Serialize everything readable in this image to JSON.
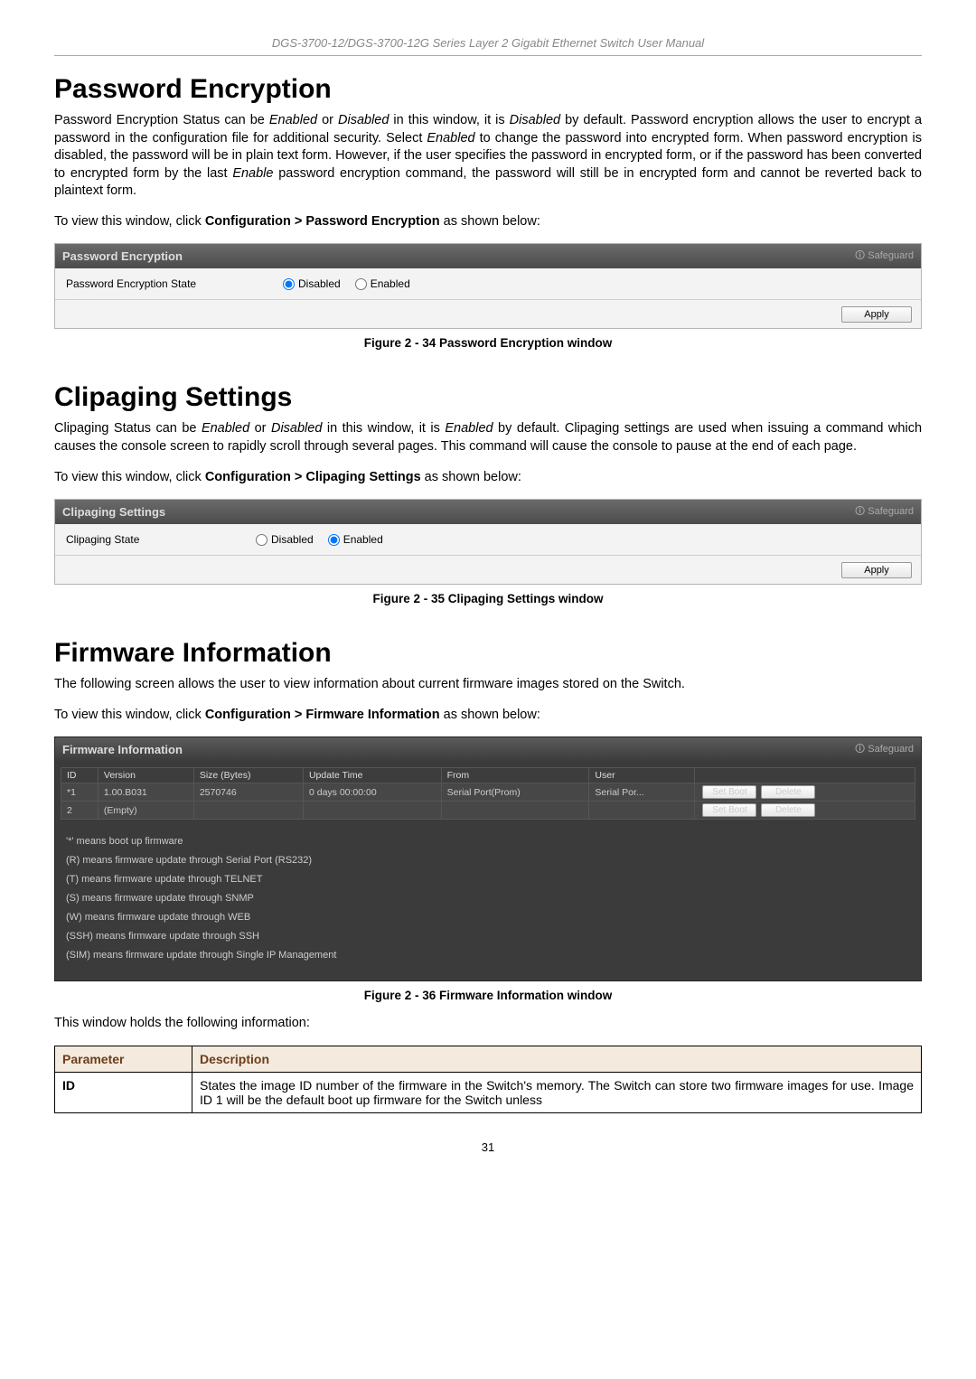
{
  "header": "DGS-3700-12/DGS-3700-12G Series Layer 2 Gigabit Ethernet Switch User Manual",
  "sections": {
    "pe": {
      "heading": "Password Encryption",
      "para_html": "Password Encryption Status can be <span class='ital'>Enabled</span> or <span class='ital'>Disabled</span> in this window, it is <span class='ital'>Disabled</span> by default. Password encryption allows the user to encrypt a password in the configuration file for additional security. Select <span class='ital'>Enabled</span> to change the password into encrypted form. When password encryption is disabled, the password will be in plain text form. However, if the user specifies the password in encrypted form, or if the password has been converted to encrypted form by the last <span class='ital'>Enable</span> password encryption command, the password will still be in encrypted form and cannot be reverted back to plaintext form.",
      "instr_html": "To view this window, click <span class='bold'>Configuration &gt; Password Encryption</span> as shown below:",
      "panel_title": "Password Encryption",
      "safeguard": "Safeguard",
      "row_label": "Password Encryption State",
      "radio_disabled": "Disabled",
      "radio_enabled": "Enabled",
      "selected": "disabled",
      "apply": "Apply",
      "caption": "Figure 2 - 34 Password Encryption window"
    },
    "cs": {
      "heading": "Clipaging Settings",
      "para_html": "Clipaging Status can be <span class='ital'>Enabled</span> or <span class='ital'>Disabled</span> in this window, it is <span class='ital'>Enabled</span> by default. Clipaging settings are used when issuing a command which causes the console screen to rapidly scroll through several pages. This command will cause the console to pause at the end of each page.",
      "instr_html": "To view this window, click <span class='bold'>Configuration &gt; Clipaging Settings</span> as shown below:",
      "panel_title": "Clipaging Settings",
      "safeguard": "Safeguard",
      "row_label": "Clipaging State",
      "radio_disabled": "Disabled",
      "radio_enabled": "Enabled",
      "selected": "enabled",
      "apply": "Apply",
      "caption": "Figure 2 - 35 Clipaging Settings window"
    },
    "fi": {
      "heading": "Firmware Information",
      "para": "The following screen allows the user to view information about current firmware images stored on the Switch.",
      "instr_html": "To view this window, click <span class='bold'>Configuration &gt; Firmware Information</span> as shown below:",
      "panel_title": "Firmware Information",
      "safeguard": "Safeguard",
      "columns": [
        "ID",
        "Version",
        "Size (Bytes)",
        "Update Time",
        "From",
        "User"
      ],
      "rows": [
        {
          "id": "*1",
          "version": "1.00.B031",
          "size": "2570746",
          "update_time": "0 days 00:00:00",
          "from": "Serial Port(Prom)",
          "user": "Serial Por..."
        },
        {
          "id": "2",
          "version": "(Empty)",
          "size": "",
          "update_time": "",
          "from": "",
          "user": ""
        }
      ],
      "set_boot": "Set Boot",
      "delete": "Delete",
      "legends": [
        "'*' means boot up firmware",
        "(R) means firmware update through Serial Port (RS232)",
        "(T) means firmware update through TELNET",
        "(S) means firmware update through SNMP",
        "(W) means firmware update through WEB",
        "(SSH) means firmware update through SSH",
        "(SIM) means firmware update through Single IP Management"
      ],
      "caption": "Figure 2 - 36 Firmware Information window",
      "after_caption": "This window holds the following information:",
      "param_header": [
        "Parameter",
        "Description"
      ],
      "param_row": {
        "id": "ID",
        "desc": "States the image ID number of the firmware in the Switch's memory. The Switch can store two firmware images for use. Image ID 1 will be the default boot up firmware for the Switch unless"
      }
    }
  },
  "pagenum": "31"
}
